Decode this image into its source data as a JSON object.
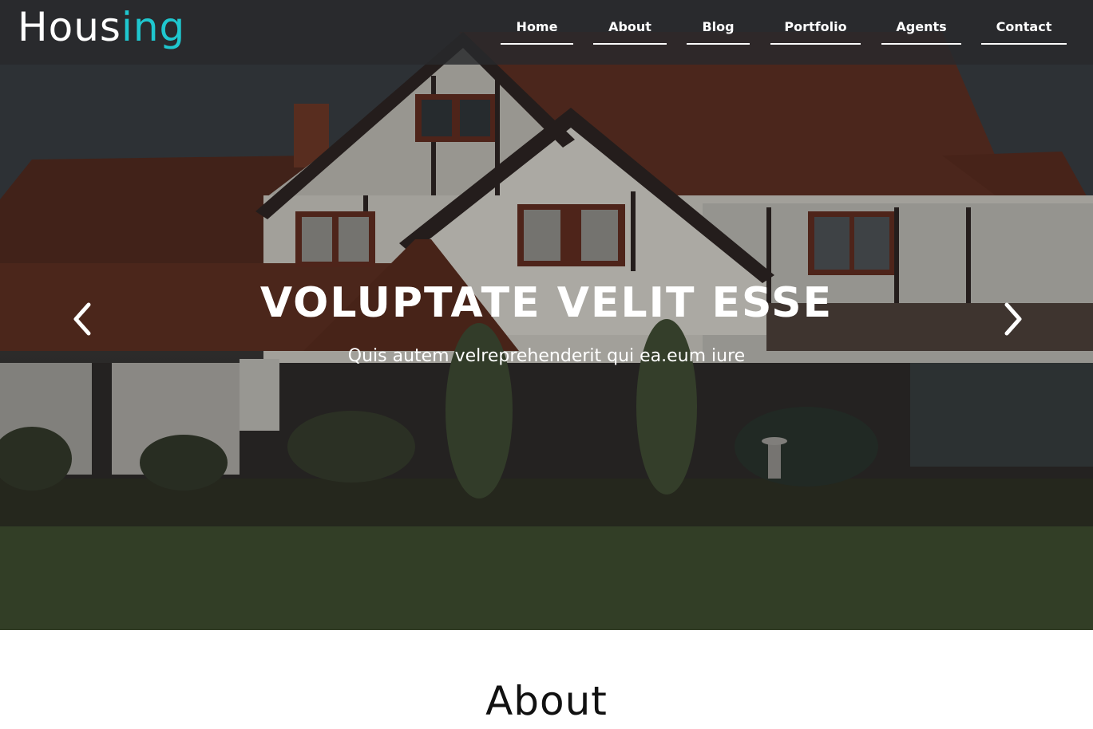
{
  "brand": {
    "part1": "Hous",
    "part2": "ing",
    "accent_color": "#1fc7cf"
  },
  "nav": {
    "items": [
      {
        "label": "Home"
      },
      {
        "label": "About"
      },
      {
        "label": "Blog"
      },
      {
        "label": "Portfolio"
      },
      {
        "label": "Agents"
      },
      {
        "label": "Contact"
      }
    ]
  },
  "hero": {
    "title": "VOLUPTATE VELIT ESSE",
    "subtitle": "Quis autem velreprehenderit qui ea.eum iure",
    "prev_icon": "chevron-left-icon",
    "next_icon": "chevron-right-icon"
  },
  "about": {
    "title": "About"
  }
}
